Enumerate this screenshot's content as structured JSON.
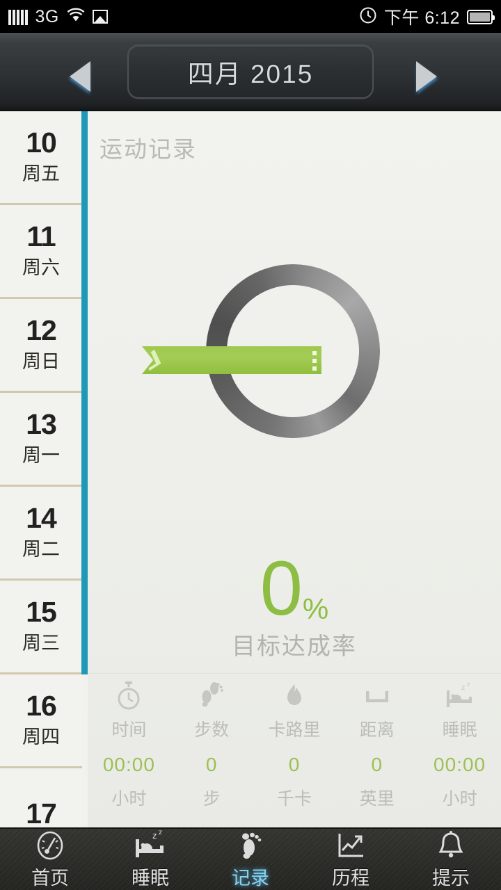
{
  "statusbar": {
    "network_label": "3G",
    "time": "下午 6:12",
    "icons": [
      "signal-bars-icon",
      "wifi-icon",
      "picture-icon",
      "clock-icon",
      "battery-icon"
    ]
  },
  "header": {
    "month_year": "四月  2015",
    "prev_label": "prev-month-arrow",
    "next_label": "next-month-arrow"
  },
  "sidebar": {
    "days": [
      {
        "num": "10",
        "weekday": "周五"
      },
      {
        "num": "11",
        "weekday": "周六"
      },
      {
        "num": "12",
        "weekday": "周日"
      },
      {
        "num": "13",
        "weekday": "周一"
      },
      {
        "num": "14",
        "weekday": "周二"
      },
      {
        "num": "15",
        "weekday": "周三"
      },
      {
        "num": "16",
        "weekday": "周四"
      },
      {
        "num": "17",
        "weekday": ""
      }
    ],
    "accent_color": "#1e99b8",
    "divider_color": "#d3c8ad"
  },
  "main": {
    "title": "运动记录",
    "progress": {
      "percent_value": "0",
      "percent_sign": "%",
      "percent_label": "目标达成率",
      "ring_color": "#6e6e6e",
      "accent_color": "#8dbe43"
    },
    "stats": [
      {
        "icon": "stopwatch-icon",
        "label": "时间",
        "value": "00:00",
        "unit": "小时"
      },
      {
        "icon": "footprints-icon",
        "label": "步数",
        "value": "0",
        "unit": "步"
      },
      {
        "icon": "flame-icon",
        "label": "卡路里",
        "value": "0",
        "unit": "千卡"
      },
      {
        "icon": "ruler-icon",
        "label": "距离",
        "value": "0",
        "unit": "英里"
      },
      {
        "icon": "bed-sleep-icon",
        "label": "睡眠",
        "value": "00:00",
        "unit": "小时"
      }
    ]
  },
  "tabbar": {
    "active_index": 2,
    "active_color": "#86d3ef",
    "tabs": [
      {
        "icon": "gauge-icon",
        "label": "首页"
      },
      {
        "icon": "bed-sleep-icon",
        "label": "睡眠"
      },
      {
        "icon": "footprint-icon",
        "label": "记录"
      },
      {
        "icon": "line-chart-icon",
        "label": "历程"
      },
      {
        "icon": "bell-icon",
        "label": "提示"
      }
    ]
  }
}
